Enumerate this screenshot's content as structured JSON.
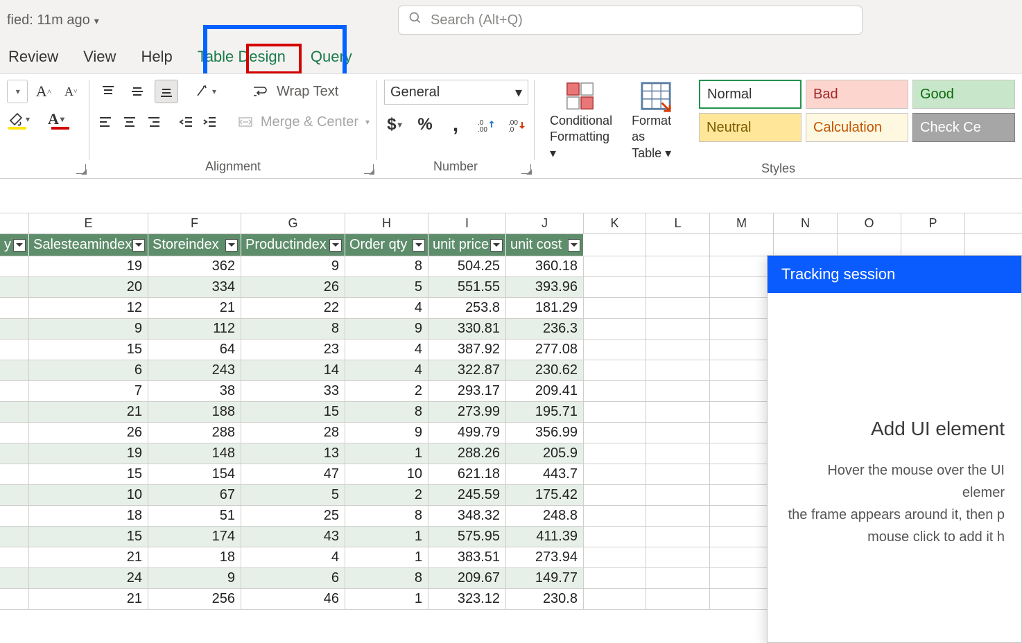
{
  "titlebar": {
    "modified": "fied: 11m ago"
  },
  "search": {
    "placeholder": "Search (Alt+Q)"
  },
  "tabs": {
    "review": "Review",
    "view": "View",
    "help": "Help",
    "tableDesign": "Table Design",
    "query": "Query"
  },
  "ribbon": {
    "wrapText": "Wrap Text",
    "mergeCenter": "Merge & Center",
    "alignmentLabel": "Alignment",
    "numberFormat": "General",
    "numberLabel": "Number",
    "conditional": "Conditional Formatting",
    "formatTable": "Format as Table",
    "stylesLabel": "Styles",
    "styleCells": {
      "normal": "Normal",
      "bad": "Bad",
      "good": "Good",
      "neutral": "Neutral",
      "calc": "Calculation",
      "check": "Check Ce"
    }
  },
  "grid": {
    "cols": [
      "E",
      "F",
      "G",
      "H",
      "I",
      "J",
      "K",
      "L",
      "M",
      "N",
      "O",
      "P"
    ],
    "headers": {
      "D": "y",
      "E": "Salesteamindex",
      "F": "Storeindex",
      "G": "Productindex",
      "H": "Order qty",
      "I": "unit price",
      "J": "unit cost"
    },
    "rows": [
      {
        "E": "19",
        "F": "362",
        "G": "9",
        "H": "8",
        "I": "504.25",
        "J": "360.18"
      },
      {
        "E": "20",
        "F": "334",
        "G": "26",
        "H": "5",
        "I": "551.55",
        "J": "393.96"
      },
      {
        "E": "12",
        "F": "21",
        "G": "22",
        "H": "4",
        "I": "253.8",
        "J": "181.29"
      },
      {
        "E": "9",
        "F": "112",
        "G": "8",
        "H": "9",
        "I": "330.81",
        "J": "236.3"
      },
      {
        "E": "15",
        "F": "64",
        "G": "23",
        "H": "4",
        "I": "387.92",
        "J": "277.08"
      },
      {
        "E": "6",
        "F": "243",
        "G": "14",
        "H": "4",
        "I": "322.87",
        "J": "230.62"
      },
      {
        "E": "7",
        "F": "38",
        "G": "33",
        "H": "2",
        "I": "293.17",
        "J": "209.41"
      },
      {
        "E": "21",
        "F": "188",
        "G": "15",
        "H": "8",
        "I": "273.99",
        "J": "195.71"
      },
      {
        "E": "26",
        "F": "288",
        "G": "28",
        "H": "9",
        "I": "499.79",
        "J": "356.99"
      },
      {
        "E": "19",
        "F": "148",
        "G": "13",
        "H": "1",
        "I": "288.26",
        "J": "205.9"
      },
      {
        "E": "15",
        "F": "154",
        "G": "47",
        "H": "10",
        "I": "621.18",
        "J": "443.7"
      },
      {
        "E": "10",
        "F": "67",
        "G": "5",
        "H": "2",
        "I": "245.59",
        "J": "175.42"
      },
      {
        "E": "18",
        "F": "51",
        "G": "25",
        "H": "8",
        "I": "348.32",
        "J": "248.8"
      },
      {
        "E": "15",
        "F": "174",
        "G": "43",
        "H": "1",
        "I": "575.95",
        "J": "411.39"
      },
      {
        "E": "21",
        "F": "18",
        "G": "4",
        "H": "1",
        "I": "383.51",
        "J": "273.94"
      },
      {
        "E": "24",
        "F": "9",
        "G": "6",
        "H": "8",
        "I": "209.67",
        "J": "149.77"
      },
      {
        "E": "21",
        "F": "256",
        "G": "46",
        "H": "1",
        "I": "323.12",
        "J": "230.8"
      }
    ]
  },
  "panel": {
    "title": "Tracking session",
    "heading": "Add UI element",
    "body1": "Hover the mouse over the UI elemer",
    "body2": "the frame appears around it, then p",
    "body3": "mouse click to add it h"
  }
}
